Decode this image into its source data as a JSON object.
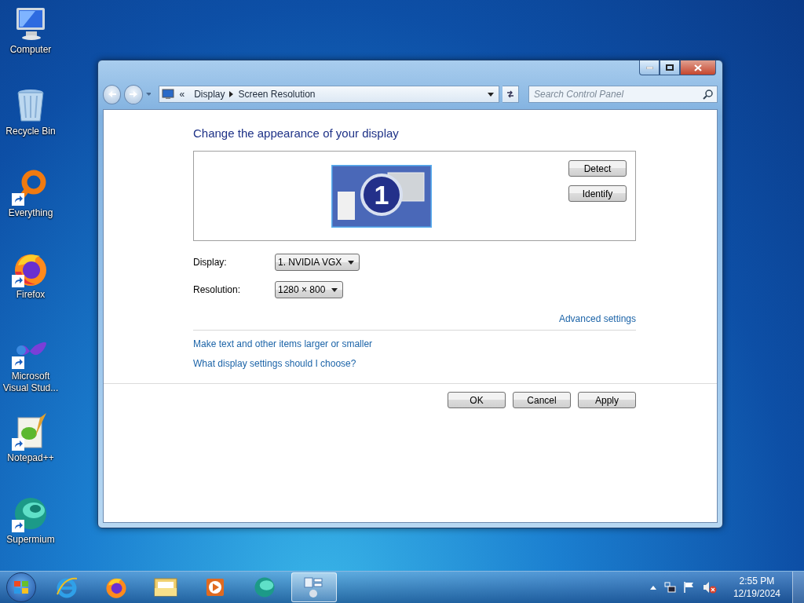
{
  "desktop_icons": [
    {
      "label": "Computer",
      "kind": "computer",
      "shortcut": false
    },
    {
      "label": "Recycle Bin",
      "kind": "recycle-bin",
      "shortcut": false
    },
    {
      "label": "Everything",
      "kind": "everything",
      "shortcut": true
    },
    {
      "label": "Firefox",
      "kind": "firefox",
      "shortcut": true
    },
    {
      "label": "Microsoft Visual Stud...",
      "kind": "visual-studio",
      "shortcut": true
    },
    {
      "label": "Notepad++",
      "kind": "notepad",
      "shortcut": true
    },
    {
      "label": "Supermium",
      "kind": "supermium",
      "shortcut": true
    }
  ],
  "window": {
    "breadcrumb": [
      "Display",
      "Screen Resolution"
    ],
    "breadcrumb_prefix": "«",
    "search": {
      "placeholder": "Search Control Panel"
    },
    "heading": "Change the appearance of your display",
    "monitor": {
      "number": "1"
    },
    "side_buttons": [
      "Detect",
      "Identify"
    ],
    "fields": [
      {
        "label": "Display:",
        "value": "1. NVIDIA VGX"
      },
      {
        "label": "Resolution:",
        "value": "1280 × 800"
      }
    ],
    "advanced_link": "Advanced settings",
    "links": [
      "Make text and other items larger or smaller",
      "What display settings should I choose?"
    ],
    "dialog_buttons": [
      "OK",
      "Cancel",
      "Apply"
    ]
  },
  "taskbar": {
    "apps": [
      {
        "kind": "ie",
        "selected": false
      },
      {
        "kind": "firefox",
        "selected": false
      },
      {
        "kind": "explorer",
        "selected": false
      },
      {
        "kind": "media",
        "selected": false
      },
      {
        "kind": "supermium",
        "selected": false
      },
      {
        "kind": "control-panel",
        "selected": true
      }
    ],
    "time": "2:55 PM",
    "date": "12/19/2024"
  }
}
